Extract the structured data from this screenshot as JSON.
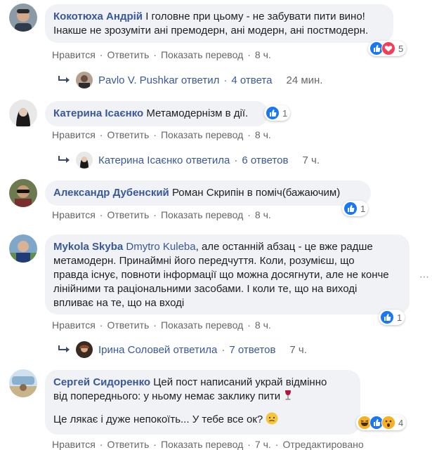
{
  "actions": {
    "like": "Нравится",
    "reply": "Ответить",
    "translate": "Показать перевод",
    "edited": "Отредактировано"
  },
  "comments": [
    {
      "author": "Кокотюха Андрій",
      "text_lines": [
        "І головне при цьому - не забувати пити вино!",
        "Інакше не зрозуміти ані премодерн, ані модерн, ані постмодерн."
      ],
      "time": "8 ч.",
      "reactions": {
        "icons": [
          "like-icon",
          "love-icon"
        ],
        "count": "5"
      },
      "reply": {
        "name": "Pavlo V. Pushkar ответил",
        "count": "4 ответа",
        "time": "24 мин."
      }
    },
    {
      "author": "Катерина Ісаєнко",
      "text": "Метамодернізм в дії.",
      "time": "8 ч.",
      "reactions": {
        "icons": [
          "like-icon"
        ],
        "count": "1"
      },
      "reply": {
        "name": "Катерина Ісаєнко ответила",
        "count": "6 ответов",
        "time": "7 ч."
      }
    },
    {
      "author": "Александр Дубенский",
      "text": "Роман Скрипін в поміч(бажаючим)",
      "time": "8 ч.",
      "reactions": {
        "icons": [
          "like-icon"
        ],
        "count": "1"
      }
    },
    {
      "author": "Mykola Skyba",
      "mention": "Dmytro Kuleba",
      "text_lines": [
        ", але останній абзац - це вже радше",
        "метамодерн. Принаймні його передчуття. Коли, розумієш, що",
        "правда існує, повноти інформації що можна досягнути, але не конче",
        "лінійними та раціональними засобами. І коли те, що на виході",
        "впливає на те, що на вході"
      ],
      "time": "8 ч.",
      "reactions": {
        "icons": [
          "like-icon"
        ],
        "count": "1"
      },
      "reply": {
        "name": "Ірина Соловей ответила",
        "count": "7 ответов",
        "time": "7 ч."
      }
    },
    {
      "author": "Сергей Сидоренко",
      "text_lines": [
        "Цей пост написаний украй відмінно",
        "від попереднього: у ньому немає заклику пити"
      ],
      "text2": "Це лякає і дуже непокоїть... У тебе все ок?",
      "time": "7 ч.",
      "reactions": {
        "icons": [
          "haha-icon",
          "like-icon",
          "wow-icon"
        ],
        "count": "4"
      }
    }
  ],
  "colors": {
    "link": "#385898",
    "bubble": "#f0f2f5",
    "meta": "#65676b",
    "like": "#1877f2",
    "love": "#f33e58"
  }
}
